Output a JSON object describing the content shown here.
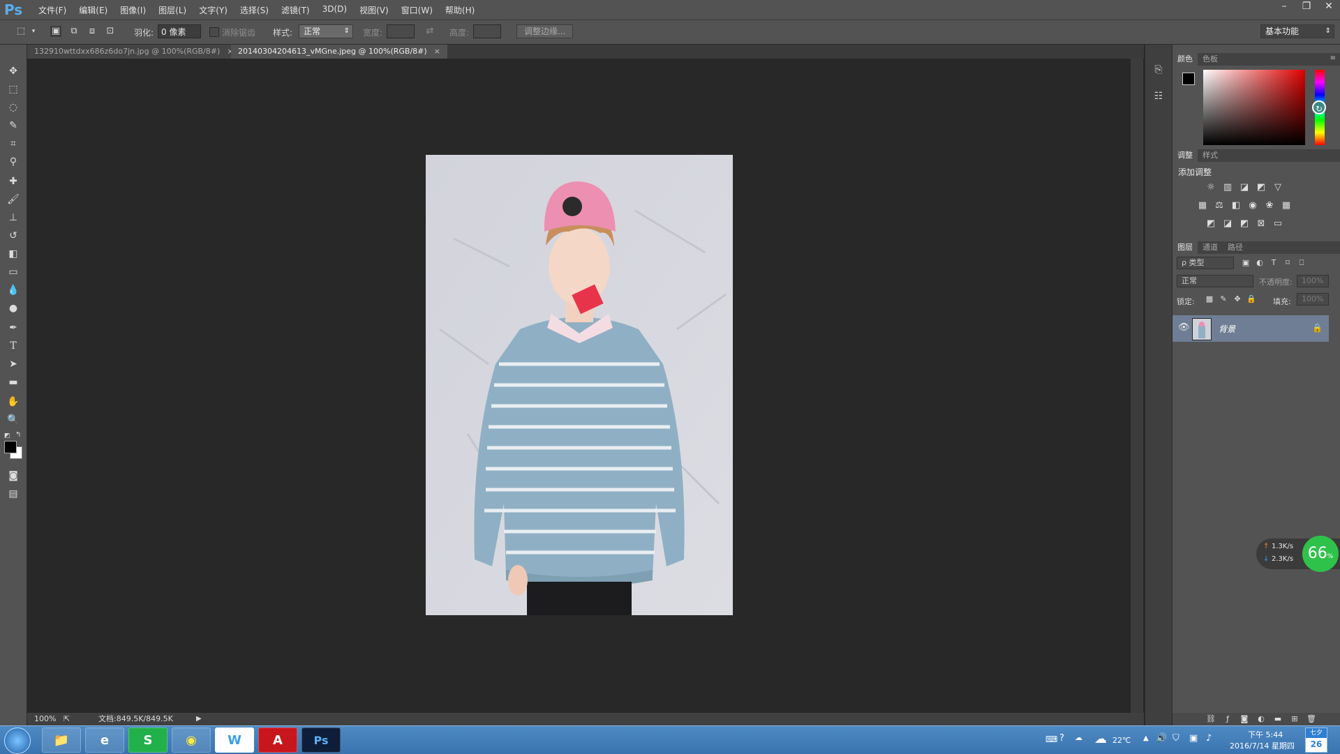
{
  "app": {
    "name": "Ps"
  },
  "menu": [
    "文件(F)",
    "编辑(E)",
    "图像(I)",
    "图层(L)",
    "文字(Y)",
    "选择(S)",
    "滤镜(T)",
    "3D(D)",
    "视图(V)",
    "窗口(W)",
    "帮助(H)"
  ],
  "window_controls": {
    "minimize": "–",
    "restore": "❐",
    "close": "✕"
  },
  "options": {
    "feather_label": "羽化:",
    "feather_value": "0 像素",
    "antialias_label": "消除锯齿",
    "style_label": "样式:",
    "style_value": "正常",
    "width_label": "宽度:",
    "height_label": "高度:",
    "refine_edge_label": "调整边缘...",
    "workspace": "基本功能"
  },
  "tabs": [
    {
      "label": "132910wttdxx686z6do7jn.jpg @ 100%(RGB/8#)",
      "close": "×"
    },
    {
      "label": "20140304204613_vMGne.jpeg @ 100%(RGB/8#)",
      "close": "×"
    }
  ],
  "status": {
    "zoom": "100%",
    "doc_size": "文档:849.5K/849.5K"
  },
  "panels": {
    "color_tabs": [
      "颜色",
      "色板"
    ],
    "adjust_tabs": [
      "调整",
      "样式"
    ],
    "add_adjustment": "添加调整",
    "layers_tabs": [
      "图层",
      "通道",
      "路径"
    ],
    "kind_filter": "ρ 类型",
    "blend_mode": "正常",
    "opacity_label": "不透明度:",
    "opacity_value": "100%",
    "lock_label": "锁定:",
    "fill_label": "填充:",
    "fill_value": "100%",
    "layer_name": "背景"
  },
  "network": {
    "up": "1.3K/s",
    "down": "2.3K/s",
    "percent": "66",
    "percent_sign": "%"
  },
  "taskbar": {
    "weather": "22℃",
    "time": "下午 5:44",
    "date": "2016/7/14 星期四",
    "calendar_top": "七夕",
    "calendar_day": "26",
    "apps": [
      {
        "name": "explorer",
        "label": "📁"
      },
      {
        "name": "browser",
        "label": "e"
      },
      {
        "name": "spreadsheet",
        "label": "S"
      },
      {
        "name": "media",
        "label": "◉"
      },
      {
        "name": "writer",
        "label": "W"
      },
      {
        "name": "acrobat",
        "label": "A"
      },
      {
        "name": "photoshop",
        "label": "Ps"
      }
    ]
  },
  "colors": {
    "accent": "#5aaef0",
    "panel": "#535353",
    "canvas": "#282828",
    "taskbar": "#3a74b0",
    "selected_layer": "#6f7e94"
  }
}
